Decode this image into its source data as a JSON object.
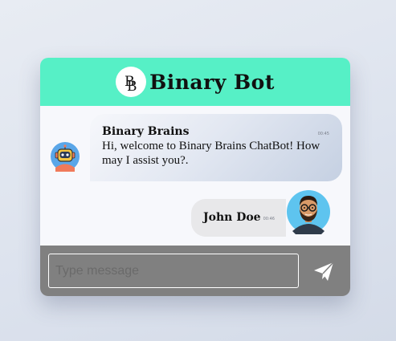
{
  "header": {
    "logo_text": "BB",
    "title": "Binary Bot"
  },
  "messages": [
    {
      "sender": "Binary Brains",
      "time": "00:45",
      "text": "Hi, welcome to Binary Brains ChatBot! How may I assist you?.",
      "avatar_icon": "robot-avatar-icon"
    },
    {
      "sender": "John Doe",
      "time": "00:46",
      "text": "",
      "avatar_icon": "user-avatar-icon"
    }
  ],
  "composer": {
    "placeholder": "Type message",
    "send_icon": "paper-plane-icon"
  },
  "colors": {
    "header_bg": "#56f0c6",
    "composer_bg": "#808080",
    "bot_bubble_end": "#c5d0e2",
    "user_bubble": "#e8e8ea"
  }
}
